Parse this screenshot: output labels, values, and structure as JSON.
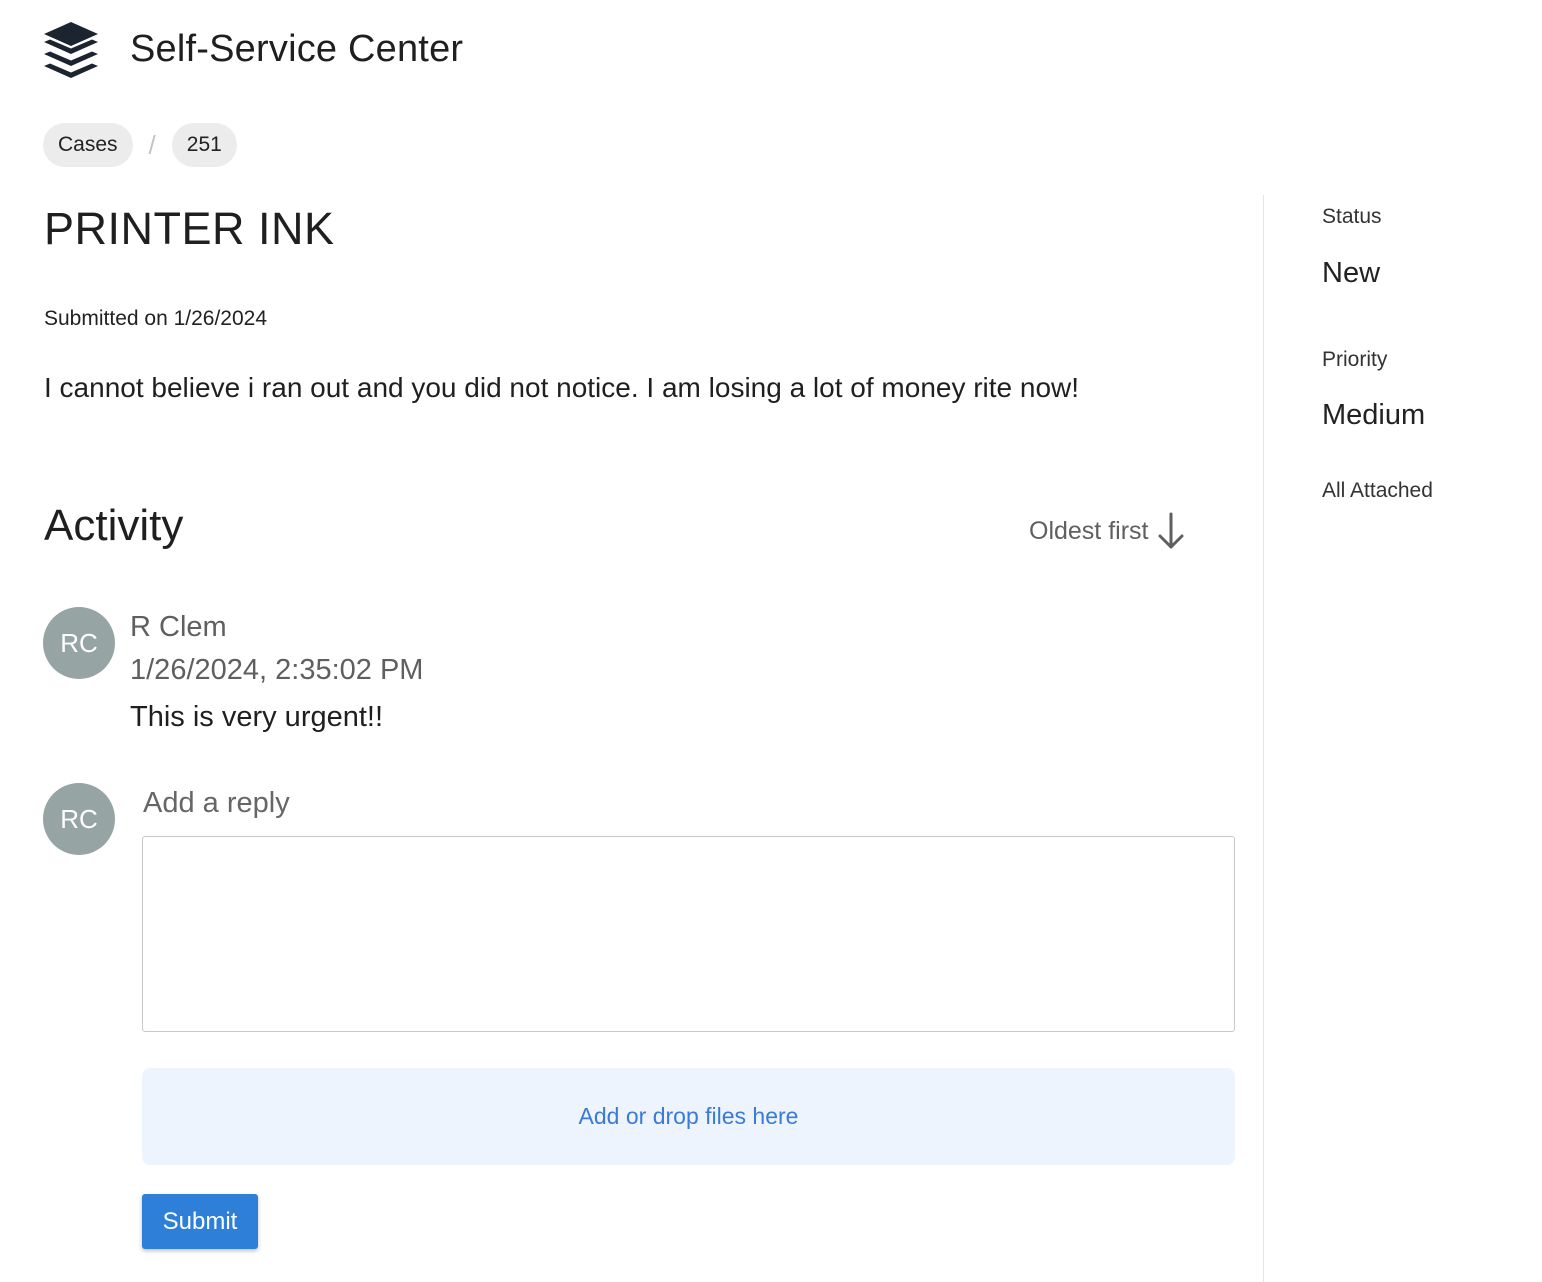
{
  "app": {
    "title": "Self-Service Center",
    "logo_icon": "stack-layers-icon"
  },
  "breadcrumb": {
    "items": [
      {
        "label": "Cases"
      },
      {
        "label": "251"
      }
    ],
    "separator": "/"
  },
  "case": {
    "title": "PRINTER INK",
    "submitted": "Submitted on 1/26/2024",
    "description": "I cannot believe i ran out and you did not notice. I am losing a lot of money rite now!"
  },
  "activity": {
    "title": "Activity",
    "sort_label": "Oldest first",
    "sort_icon": "arrow-down-icon",
    "comments": [
      {
        "initials": "RC",
        "author": "R Clem",
        "timestamp": "1/26/2024, 2:35:02 PM",
        "body": "This is very urgent!!"
      }
    ]
  },
  "reply": {
    "initials": "RC",
    "label": "Add a reply",
    "value": "",
    "dropzone_label": "Add or drop files here",
    "submit_label": "Submit"
  },
  "sidebar": {
    "status_label": "Status",
    "status_value": "New",
    "priority_label": "Priority",
    "priority_value": "Medium",
    "attachments_label": "All Attached"
  },
  "colors": {
    "avatar_bg": "#96a4a3",
    "primary_button": "#2d7fd8",
    "dropzone_bg": "#edf4fd",
    "dropzone_text": "#3a7bd5",
    "logo": "#1c2430"
  }
}
